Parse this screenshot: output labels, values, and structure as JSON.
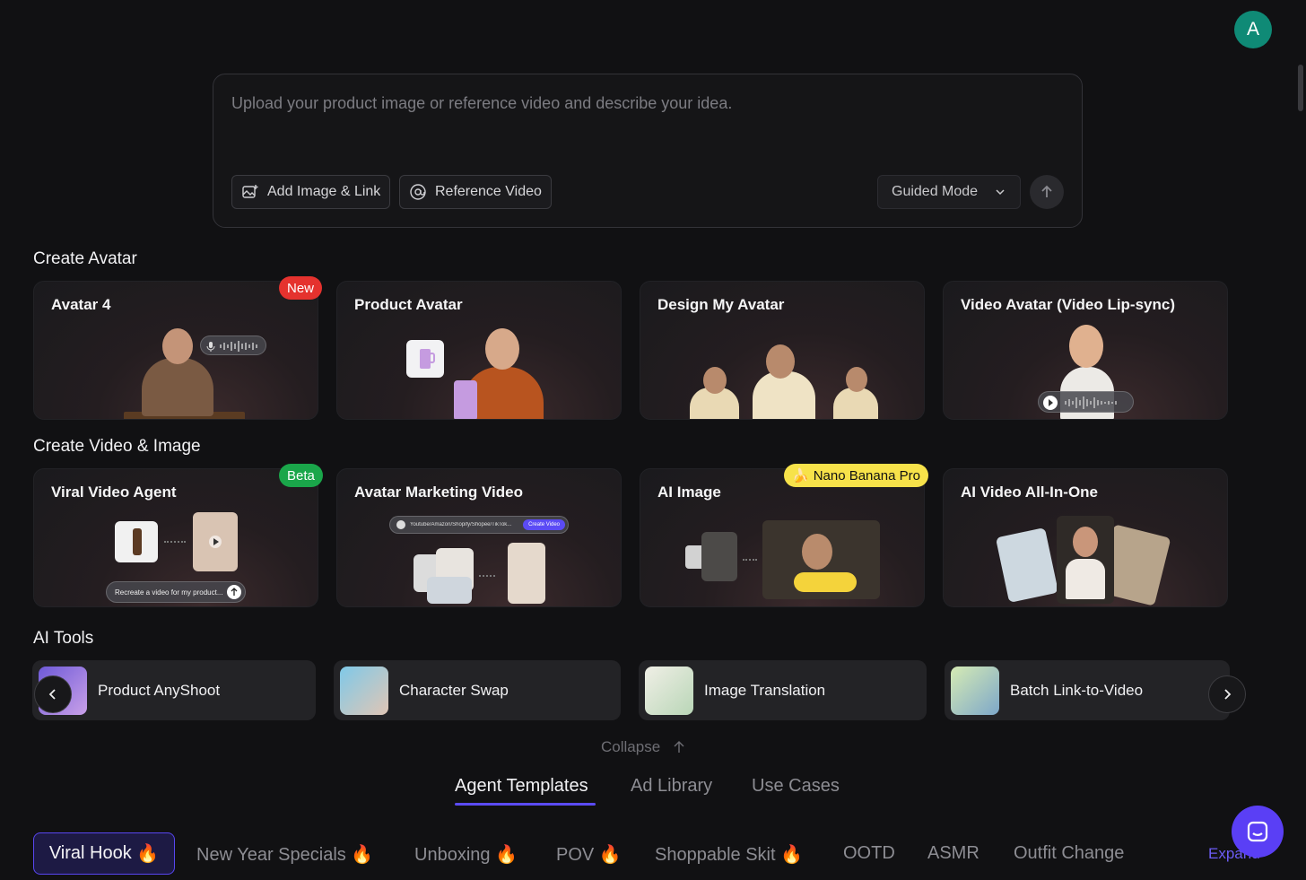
{
  "user": {
    "initial": "A"
  },
  "prompt": {
    "placeholder": "Upload your product image or reference video and describe your idea.",
    "add_image_label": "Add Image & Link",
    "reference_video_label": "Reference Video",
    "mode_label": "Guided Mode"
  },
  "create_avatar": {
    "title": "Create Avatar",
    "cards": [
      {
        "label": "Avatar 4",
        "badge": "New"
      },
      {
        "label": "Product Avatar"
      },
      {
        "label": "Design My Avatar"
      },
      {
        "label": "Video Avatar (Video Lip-sync)"
      }
    ]
  },
  "create_video": {
    "title": "Create Video & Image",
    "cards": [
      {
        "label": "Viral Video Agent",
        "badge": "Beta",
        "mini_prompt": "Recreate a video for my product..."
      },
      {
        "label": "Avatar Marketing Video",
        "mini_input": "Youtube/Amazon/Shopify/Shopee/TikTok...",
        "mini_button": "Create Video"
      },
      {
        "label": "AI Image",
        "badge": "Nano Banana Pro"
      },
      {
        "label": "AI Video All-In-One"
      }
    ]
  },
  "ai_tools": {
    "title": "AI Tools",
    "items": [
      {
        "label": "Product AnyShoot"
      },
      {
        "label": "Character Swap"
      },
      {
        "label": "Image Translation"
      },
      {
        "label": "Batch Link-to-Video"
      }
    ]
  },
  "collapse_label": "Collapse",
  "tabs": [
    "Agent Templates",
    "Ad Library",
    "Use Cases"
  ],
  "chips": [
    "Viral Hook",
    "New Year Specials",
    "Unboxing",
    "POV",
    "Shoppable Skit",
    "OOTD",
    "ASMR",
    "Outfit Change"
  ],
  "fire_emoji": "🔥",
  "banana_emoji": "🍌",
  "expand_label": "Expand",
  "colors": {
    "accent": "#5b4bf5",
    "badge_new": "#e5322e",
    "badge_beta": "#1aa64a",
    "badge_nano": "#f7e24a",
    "avatar": "#0f8a76"
  }
}
